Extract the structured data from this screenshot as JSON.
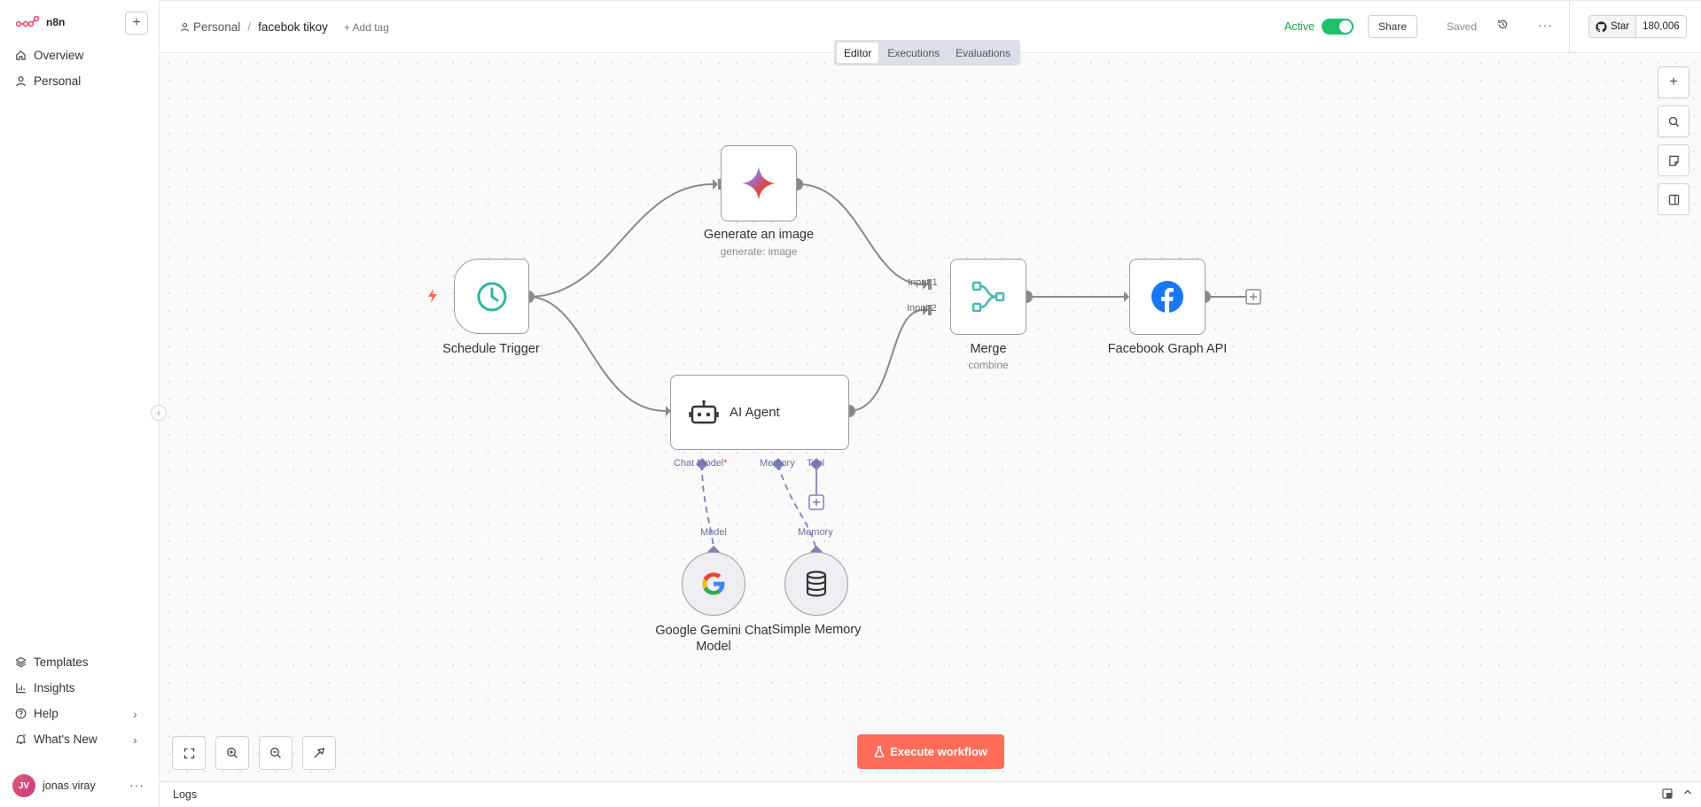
{
  "brand": {
    "name": "n8n"
  },
  "sidebar": {
    "top_items": [
      {
        "label": "Overview",
        "icon": "home-icon"
      },
      {
        "label": "Personal",
        "icon": "user-icon"
      }
    ],
    "bottom_items": [
      {
        "label": "Templates",
        "icon": "templates-icon"
      },
      {
        "label": "Insights",
        "icon": "chart-icon"
      },
      {
        "label": "Help",
        "icon": "help-icon"
      },
      {
        "label": "What's New",
        "icon": "bell-icon"
      }
    ],
    "user": {
      "initials": "JV",
      "name": "jonas viray"
    }
  },
  "header": {
    "project": "Personal",
    "workflow_name": "facebok tikoy",
    "add_tag": "+ Add tag",
    "active_label": "Active",
    "active": true,
    "share": "Share",
    "saved": "Saved",
    "github_star": "Star",
    "github_count": "180,006"
  },
  "tabs": [
    {
      "label": "Editor",
      "selected": true
    },
    {
      "label": "Executions",
      "selected": false
    },
    {
      "label": "Evaluations",
      "selected": false
    }
  ],
  "nodes": {
    "schedule": {
      "title": "Schedule Trigger"
    },
    "image": {
      "title": "Generate an image",
      "subtitle": "generate: image"
    },
    "merge": {
      "title": "Merge",
      "subtitle": "combine",
      "input1": "Input 1",
      "input2": "Input 2"
    },
    "facebook": {
      "title": "Facebook Graph API"
    },
    "agent": {
      "title": "AI Agent",
      "port_chat": "Chat Model",
      "port_chat_required": "*",
      "port_memory": "Memory",
      "port_tool": "Tool"
    },
    "gemini": {
      "title_line1": "Google Gemini Chat",
      "title_line2": "Model",
      "port": "Model"
    },
    "memory": {
      "title": "Simple Memory",
      "port": "Memory"
    }
  },
  "execute": {
    "label": "Execute workflow"
  },
  "logs": {
    "label": "Logs"
  },
  "colors": {
    "accent": "#ff6d5a",
    "active": "#1fc168",
    "subnode_port": "#7f81b8"
  }
}
